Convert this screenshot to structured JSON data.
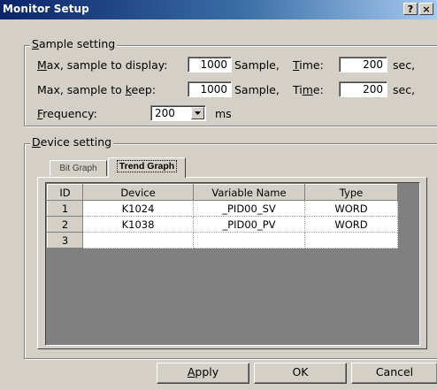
{
  "window": {
    "title": "Monitor Setup",
    "help_label": "?",
    "close_label": "×"
  },
  "sample_setting": {
    "legend_u": "S",
    "legend_rest": "ample setting",
    "row1": {
      "label_u": "M",
      "label_rest": "ax, sample to display:",
      "value": "1000",
      "unit": "Sample,",
      "time_label_u": "T",
      "time_label_rest": "ime:",
      "time_value": "200",
      "time_unit": "sec,"
    },
    "row2": {
      "label_pre": "Max, sample to ",
      "label_u": "k",
      "label_post": "eep:",
      "value": "1000",
      "unit": "Sample,",
      "time_label_pre": "Ti",
      "time_label_u": "m",
      "time_label_post": "e:",
      "time_value": "200",
      "time_unit": "sec,"
    },
    "frequency": {
      "label_u": "F",
      "label_rest": "requency:",
      "value": "200",
      "unit": "ms"
    }
  },
  "device_setting": {
    "legend_u": "D",
    "legend_rest": "evice setting",
    "tabs": [
      {
        "label": "Bit Graph",
        "active": false
      },
      {
        "label": "Trend Graph",
        "active": true
      }
    ],
    "table": {
      "headers": [
        "ID",
        "Device",
        "Variable Name",
        "Type"
      ],
      "rows": [
        {
          "id": "1",
          "device": "K1024",
          "variable": "_PID00_SV",
          "type": "WORD"
        },
        {
          "id": "2",
          "device": "K1038",
          "variable": "_PID00_PV",
          "type": "WORD"
        },
        {
          "id": "3",
          "device": "",
          "variable": "",
          "type": ""
        }
      ]
    }
  },
  "buttons": {
    "apply_u": "A",
    "apply_rest": "pply",
    "ok": "OK",
    "cancel": "Cancel"
  }
}
